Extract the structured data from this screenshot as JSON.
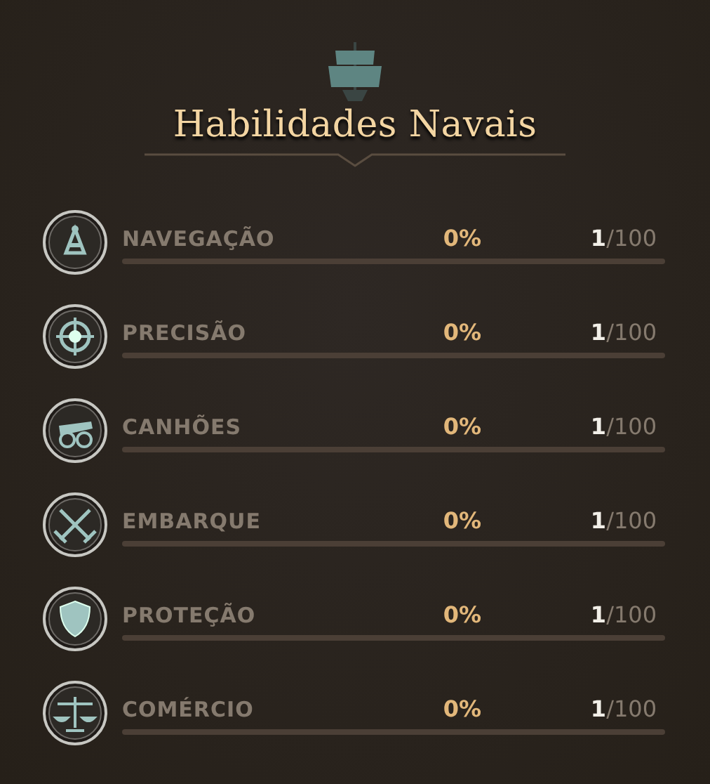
{
  "title": "Habilidades Navais",
  "skills": [
    {
      "kind": "sextant",
      "name": "NAVEGAÇÃO",
      "percent": "0%",
      "current": "1",
      "max": "/100",
      "level": 0
    },
    {
      "kind": "crosshair",
      "name": "PRECISÃO",
      "percent": "0%",
      "current": "1",
      "max": "/100",
      "level": 0
    },
    {
      "kind": "cannon",
      "name": "CANHÕES",
      "percent": "0%",
      "current": "1",
      "max": "/100",
      "level": 0
    },
    {
      "kind": "swords",
      "name": "EMBARQUE",
      "percent": "0%",
      "current": "1",
      "max": "/100",
      "level": 0
    },
    {
      "kind": "shield",
      "name": "PROTEÇÃO",
      "percent": "0%",
      "current": "1",
      "max": "/100",
      "level": 0
    },
    {
      "kind": "scales",
      "name": "COMÉRCIO",
      "percent": "0%",
      "current": "1",
      "max": "/100",
      "level": 0
    }
  ]
}
